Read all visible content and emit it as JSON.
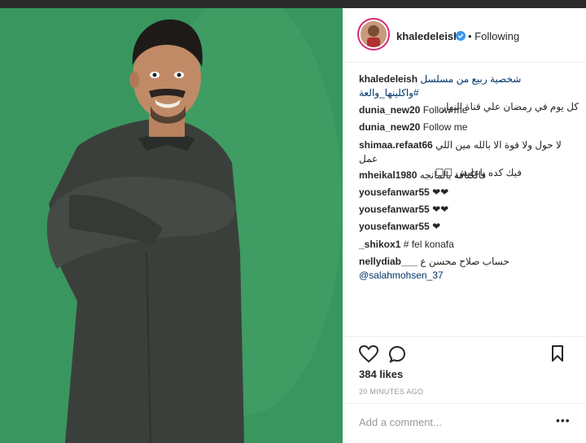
{
  "post": {
    "username": "khaledeleish",
    "follow_status": "• Following"
  },
  "caption": {
    "user": "khaledeleish",
    "text": "شخصية ربيع من مسلسل #واكلينها_والعة",
    "text2": "كل يوم في رمضان علي قناة النهار"
  },
  "comments": [
    {
      "user": "dunia_new20",
      "text": "Follow me"
    },
    {
      "user": "dunia_new20",
      "text": "Follow me"
    },
    {
      "user": "shimaa.refaat66",
      "text": "لا حول ولا قوة الا بالله مين اللي عمل",
      "text2": "فيك كده ياعليش ☐☐"
    },
    {
      "user": "mheikal1980",
      "text": "فالكنافة بالمانجه"
    },
    {
      "user": "yousefanwar55",
      "text": "❤❤"
    },
    {
      "user": "yousefanwar55",
      "text": "❤❤"
    },
    {
      "user": "yousefanwar55",
      "text": "❤"
    },
    {
      "user": "_shikox1",
      "text": "# fel konafa"
    },
    {
      "user": "nellydiab___",
      "text": "حساب صلاح محسن ع",
      "mention": "@salahmohsen_37"
    }
  ],
  "likes": "384 likes",
  "time": "20 MINUTES AGO",
  "add_comment_placeholder": "Add a comment...",
  "more_label": "•••",
  "colors": {
    "verified": "#3897f0",
    "photo_bg": "#3d9a63",
    "robe": "#3b3f3b"
  }
}
